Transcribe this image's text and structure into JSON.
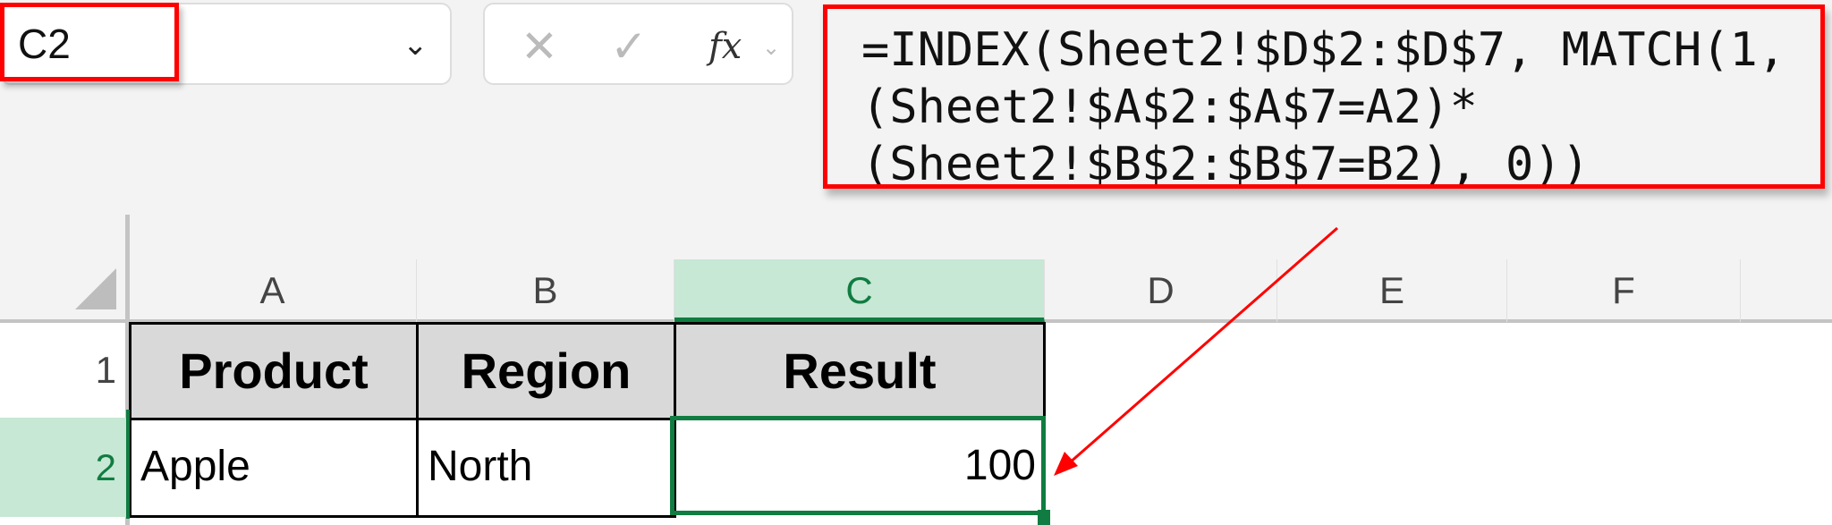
{
  "name_box": {
    "value": "C2"
  },
  "formula_bar": {
    "lines": [
      "=INDEX(Sheet2!$D$2:$D$7, MATCH(1,",
      "(Sheet2!$A$2:$A$7=A2)*",
      "(Sheet2!$B$2:$B$7=B2), 0))"
    ],
    "cancel_icon": "✕",
    "enter_icon": "✓",
    "fx_label": "fx"
  },
  "columns": [
    "A",
    "B",
    "C",
    "D",
    "E",
    "F"
  ],
  "rows": [
    "1",
    "2"
  ],
  "table": {
    "headers": [
      "Product",
      "Region",
      "Result"
    ],
    "row": [
      "Apple",
      "North",
      "100"
    ]
  },
  "colors": {
    "selection": "#107c41",
    "highlight": "#c6e8d4",
    "annotation": "#ff0000"
  }
}
